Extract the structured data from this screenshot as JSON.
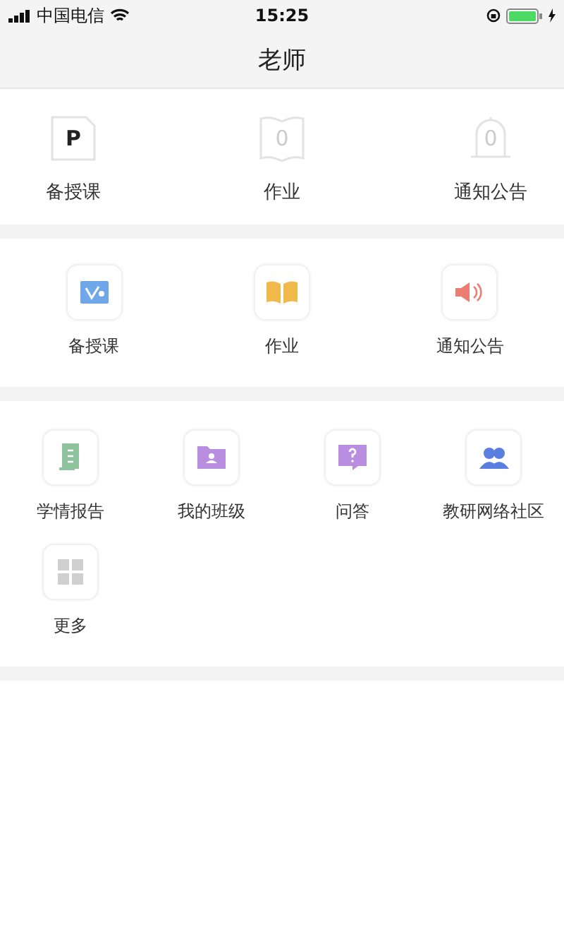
{
  "status_bar": {
    "carrier": "中国电信",
    "time": "15:25"
  },
  "nav": {
    "title": "老师"
  },
  "summary": [
    {
      "label": "备授课",
      "value": "P"
    },
    {
      "label": "作业",
      "value": "0"
    },
    {
      "label": "通知公告",
      "value": "0"
    }
  ],
  "shortcuts": [
    {
      "label": "备授课"
    },
    {
      "label": "作业"
    },
    {
      "label": "通知公告"
    }
  ],
  "apps": [
    {
      "label": "学情报告"
    },
    {
      "label": "我的班级"
    },
    {
      "label": "问答"
    },
    {
      "label": "教研网络社区"
    },
    {
      "label": "更多"
    }
  ]
}
